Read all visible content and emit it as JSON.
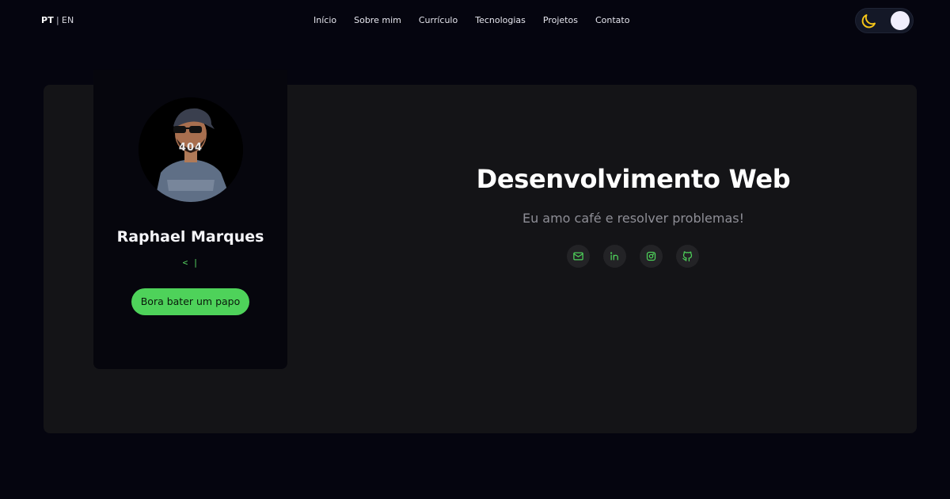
{
  "header": {
    "lang_active": "PT",
    "lang_separator": "|",
    "lang_inactive": "EN",
    "nav": [
      "Início",
      "Sobre mim",
      "Currículo",
      "Tecnologias",
      "Projetos",
      "Contato"
    ],
    "theme_toggle": {
      "mode": "dark",
      "moon_icon": "moon-icon",
      "moon_color": "#f5c518"
    }
  },
  "profile": {
    "name": "Raphael Marques",
    "typing_text": "< |",
    "cta_label": "Bora bater um papo",
    "avatar_overlay_text": "404",
    "accent": "#4ed25a"
  },
  "hero": {
    "title": "Desenvolvimento Web",
    "subtitle": "Eu amo café e resolver problemas!"
  },
  "socials": [
    {
      "name": "email",
      "icon": "mail-icon"
    },
    {
      "name": "linkedin",
      "icon": "linkedin-icon"
    },
    {
      "name": "instagram",
      "icon": "instagram-icon"
    },
    {
      "name": "github",
      "icon": "github-icon"
    }
  ],
  "colors": {
    "background": "#05050f",
    "panel": "#141417",
    "card": "#06060d",
    "accent_green": "#4ed25a",
    "muted_text": "#8e8e96"
  }
}
